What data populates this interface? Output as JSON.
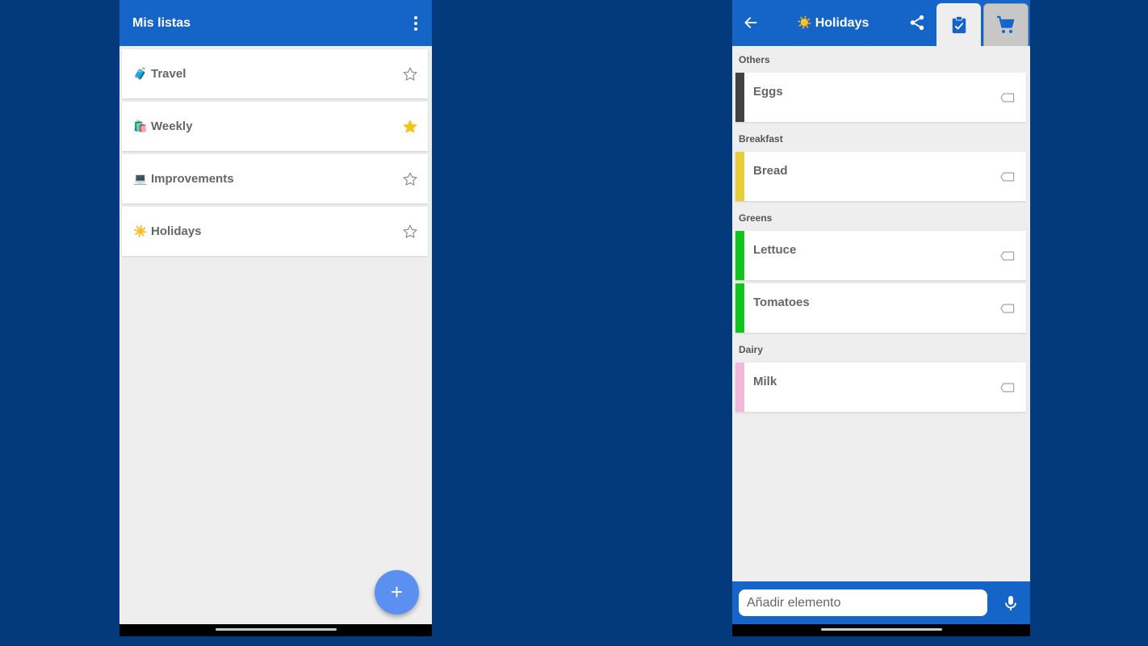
{
  "left_screen": {
    "app_title": "Mis listas",
    "lists": [
      {
        "emoji": "🧳",
        "name": "Travel",
        "starred": false
      },
      {
        "emoji": "🛍️",
        "name": "Weekly",
        "starred": true
      },
      {
        "emoji": "💻",
        "name": "Improvements",
        "starred": false
      },
      {
        "emoji": "☀️",
        "name": "Holidays",
        "starred": false
      }
    ],
    "fab_symbol": "+"
  },
  "right_screen": {
    "list_emoji": "☀️",
    "list_title": "Holidays",
    "sections": [
      {
        "label": "Others",
        "items": [
          {
            "name": "Eggs",
            "color": "#424242"
          }
        ]
      },
      {
        "label": "Breakfast",
        "items": [
          {
            "name": "Bread",
            "color": "#e8cc3a"
          }
        ]
      },
      {
        "label": "Greens",
        "items": [
          {
            "name": "Lettuce",
            "color": "#12c41e"
          },
          {
            "name": "Tomatoes",
            "color": "#12c41e"
          }
        ]
      },
      {
        "label": "Dairy",
        "items": [
          {
            "name": "Milk",
            "color": "#f2b8d8"
          }
        ]
      }
    ],
    "add_placeholder": "Añadir elemento"
  },
  "colors": {
    "background": "#023a7c",
    "appbar": "#1565c8",
    "fab": "#5b8ff0",
    "star_active": "#f5c518"
  }
}
